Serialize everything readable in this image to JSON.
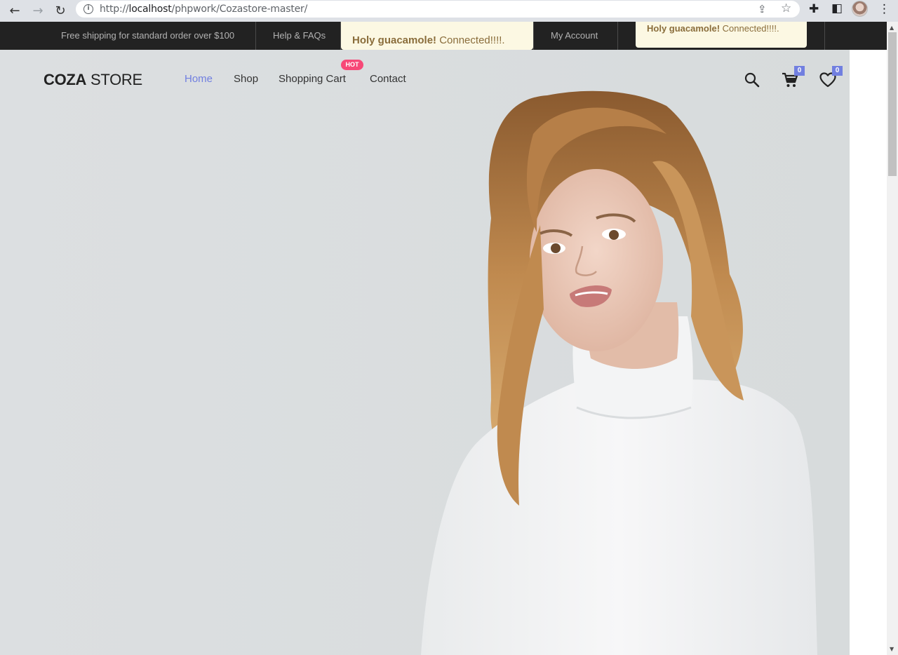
{
  "browser": {
    "url_prefix": "http://",
    "url_host": "localhost",
    "url_path": "/phpwork/Cozastore-master/"
  },
  "topbar": {
    "promo": "Free shipping for standard order over $100",
    "help": "Help & FAQs",
    "account": "My Account"
  },
  "toasts": [
    {
      "strong": "Holy guacamole!",
      "text": " Connected!!!!."
    },
    {
      "strong": "Holy guacamole!",
      "text": " Connected!!!!."
    }
  ],
  "header": {
    "logo_bold": "COZA",
    "logo_rest": " STORE",
    "nav": [
      "Home",
      "Shop",
      "Shopping Cart",
      "Contact"
    ],
    "hot_badge": "HOT",
    "cart_count": "0",
    "wishlist_count": "0"
  },
  "colors": {
    "accent": "#717fe0",
    "hot": "#f74877",
    "topbar_bg": "#222222",
    "toast_bg": "#fcf8e3"
  }
}
